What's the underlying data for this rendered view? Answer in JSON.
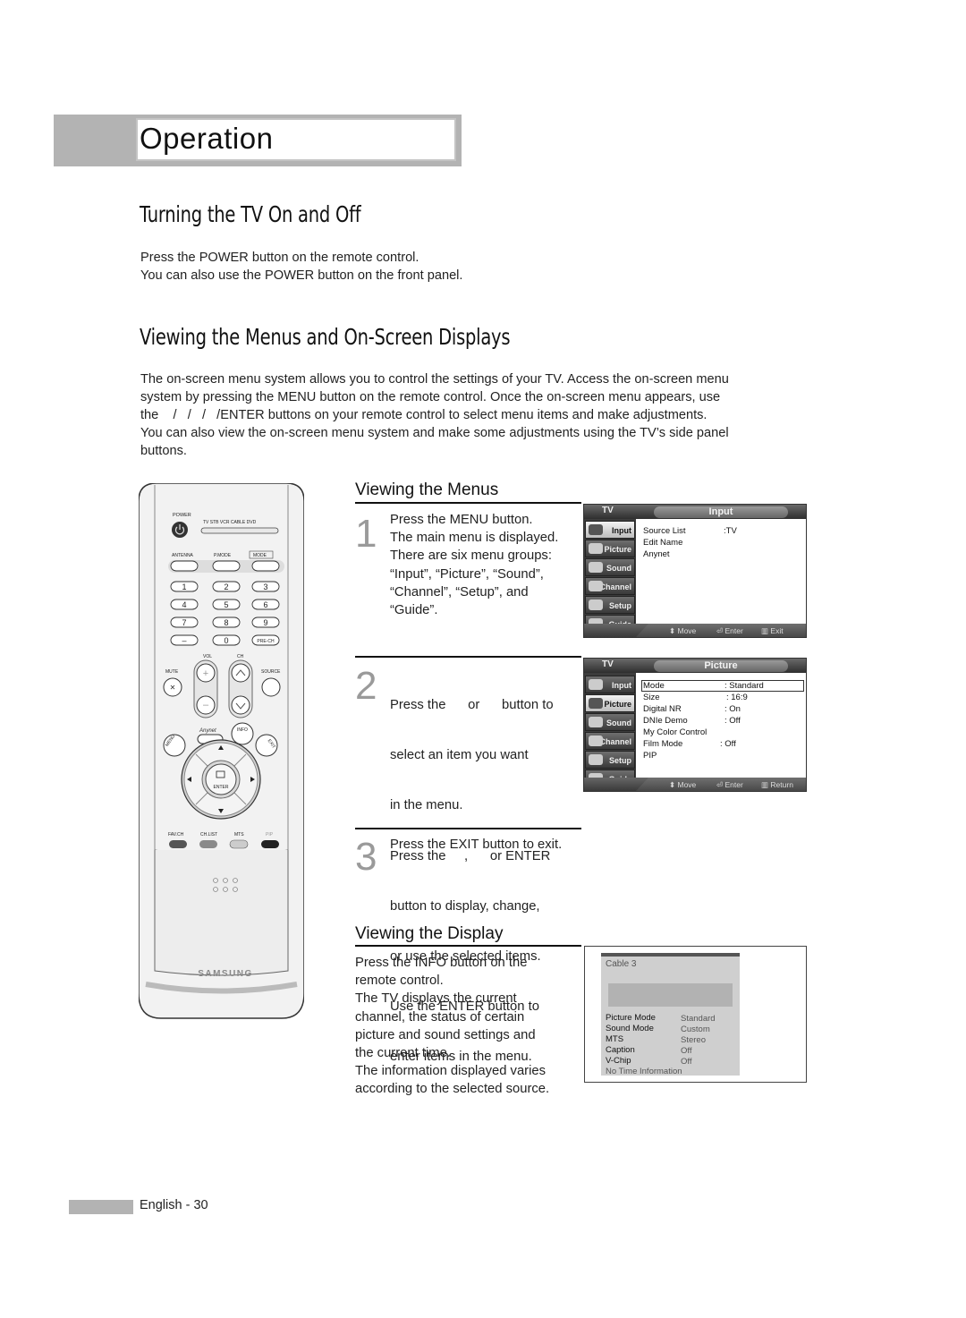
{
  "header": {
    "section_title": "Operation"
  },
  "turning_on": {
    "heading": "Turning the TV On and Off",
    "lines": [
      "Press the POWER button on the remote control.",
      "You can also use the POWER button on the front panel."
    ]
  },
  "viewing_menus_osd": {
    "heading": "Viewing the Menus and On-Screen Displays",
    "paragraph_lines": [
      "The on-screen menu system allows you to control the settings of your TV. Access the on-screen menu",
      "system by pressing the MENU button on the remote control. Once the on-screen menu appears, use",
      "the    /   /   /   /ENTER buttons on your remote control to select menu items and make adjustments.",
      "You can also view the on-screen menu system and make some adjustments using the TV’s side panel",
      "buttons."
    ]
  },
  "viewing_menus": {
    "heading": "Viewing the Menus",
    "steps": [
      {
        "number": "1",
        "lines": [
          "Press the MENU button.",
          "The main menu is displayed.",
          "There are six menu groups:",
          "“Input”, “Picture”, “Sound”,",
          "“Channel”, “Setup”, and",
          "“Guide”."
        ]
      },
      {
        "number": "2",
        "lines": [
          "Press the      or      button to",
          "select an item you want",
          "in the menu.",
          "Press the     ,      or ENTER",
          "button to display, change,",
          "or use the selected items.",
          "Use the ENTER button to",
          "enter items in the menu."
        ]
      },
      {
        "number": "3",
        "lines": [
          "Press the EXIT button to exit."
        ]
      }
    ]
  },
  "viewing_display": {
    "heading": "Viewing the Display",
    "lines": [
      "Press the INFO button on the",
      "remote control.",
      "The TV displays the current",
      "channel, the status of certain",
      "picture and sound settings and",
      "the current time.",
      "The information displayed varies",
      "according to the selected source."
    ]
  },
  "osd_menus": [
    {
      "tv_label": "TV",
      "title": "Input",
      "sidebar": [
        "Input",
        "Picture",
        "Sound",
        "Channel",
        "Setup",
        "Guide"
      ],
      "selected": "Input",
      "items": [
        {
          "label": "Source List",
          "value": ":TV"
        },
        {
          "label": "Edit Name",
          "value": ""
        },
        {
          "label": "Anynet",
          "value": ""
        }
      ],
      "help": {
        "move": "Move",
        "enter": "Enter",
        "back": "Exit"
      }
    },
    {
      "tv_label": "TV",
      "title": "Picture",
      "sidebar": [
        "Input",
        "Picture",
        "Sound",
        "Channel",
        "Setup",
        "Guide"
      ],
      "selected": "Picture",
      "items": [
        {
          "label": "Mode",
          "value": ": Standard"
        },
        {
          "label": "Size",
          "value": ": 16:9"
        },
        {
          "label": "Digital NR",
          "value": ": On"
        },
        {
          "label": "DNIe Demo",
          "value": ": Off"
        },
        {
          "label": "My Color Control",
          "value": ""
        },
        {
          "label": "Film Mode",
          "value": ": Off"
        },
        {
          "label": "PIP",
          "value": ""
        }
      ],
      "help": {
        "move": "Move",
        "enter": "Enter",
        "back": "Return"
      }
    }
  ],
  "info_display": {
    "channel": "Cable 3",
    "rows": [
      {
        "label": "Picture Mode",
        "value": "Standard"
      },
      {
        "label": "Sound Mode",
        "value": "Custom"
      },
      {
        "label": "MTS",
        "value": "Stereo"
      },
      {
        "label": "Caption",
        "value": "Off"
      },
      {
        "label": "V-Chip",
        "value": "Off"
      }
    ],
    "time": "No Time Information"
  },
  "remote": {
    "brand": "SAMSUNG",
    "labels": {
      "power": "POWER",
      "tv": "TV",
      "stb": "STB",
      "vcr": "VCR",
      "cable": "CABLE",
      "dvd": "DVD",
      "antenna": "ANTENNA",
      "pmode": "P.MODE",
      "mode": "MODE",
      "digits": [
        "1",
        "2",
        "3",
        "4",
        "5",
        "6",
        "7",
        "8",
        "9",
        "–",
        "0",
        "PRE-CH"
      ],
      "vol": "VOL",
      "ch": "CH",
      "mute": "MUTE",
      "source": "SOURCE",
      "anynet": "Anynet",
      "info": "INFO",
      "menu": "MENU",
      "exit": "EXIT",
      "enter": "ENTER",
      "favch": "FAV.CH",
      "chlist": "CH.LIST",
      "mts": "MTS",
      "pip": "PIP"
    }
  },
  "footer": {
    "page": "English - 30"
  }
}
